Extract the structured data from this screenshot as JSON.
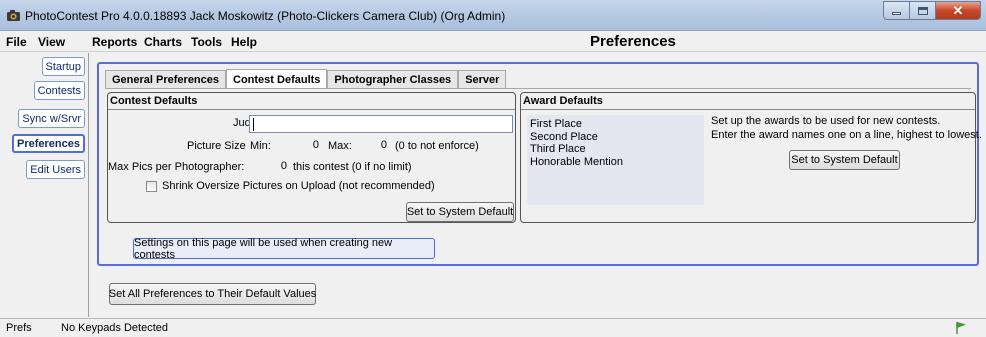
{
  "window": {
    "title": "PhotoContest Pro 4.0.0.18893 Jack Moskowitz (Photo-Clickers Camera Club) (Org Admin)",
    "buttons": {
      "minimize_icon": "minimize-icon",
      "maximize_icon": "maximize-icon",
      "close_glyph": "✕"
    }
  },
  "menu": {
    "items": [
      "File",
      "View",
      "Reports",
      "Charts",
      "Tools",
      "Help"
    ],
    "page_title": "Preferences"
  },
  "sidebar": {
    "items": [
      {
        "label": "Startup",
        "active": false
      },
      {
        "label": "Contests",
        "active": false
      },
      {
        "label": "Sync w/Srvr",
        "active": false
      },
      {
        "label": "Preferences",
        "active": true
      },
      {
        "label": "Edit Users",
        "active": false
      }
    ]
  },
  "tabs": [
    {
      "label": "General Preferences",
      "active": false
    },
    {
      "label": "Contest Defaults",
      "active": true
    },
    {
      "label": "Photographer Classes",
      "active": false
    },
    {
      "label": "Server",
      "active": false
    }
  ],
  "contest_defaults": {
    "group_title": "Contest Defaults",
    "judges_label": "Judges:",
    "judges_value": "",
    "picture_size_label": "Picture Size",
    "min_label": "Min:",
    "min_value": "0",
    "max_label": "Max:",
    "max_value": "0",
    "max_hint": "(0 to not enforce)",
    "max_pics_label": "Max Pics per Photographer:",
    "max_pics_value": "0",
    "max_pics_hint": "this contest (0 if no limit)",
    "shrink_label": "Shrink Oversize Pictures on Upload (not recommended)",
    "shrink_checked": false,
    "reset_button": "Set to System Default"
  },
  "award_defaults": {
    "group_title": "Award Defaults",
    "awards": [
      "First Place",
      "Second Place",
      "Third Place",
      "Honorable Mention"
    ],
    "help_line1": "Set up the awards to be used for new contests.",
    "help_line2": "Enter the award names one on a line, highest to lowest.",
    "reset_button": "Set to System Default"
  },
  "info_banner": "Settings on this page will be used when creating new contests",
  "reset_all_button": "Set All Preferences to Their Default Values",
  "status": {
    "left": "Prefs",
    "message": "No Keypads Detected",
    "flag_color": "#3a9a2a"
  },
  "colors": {
    "accent_border": "#5a6ae0",
    "sidebar_text": "#102a6b",
    "close_button": "#c7482a"
  }
}
